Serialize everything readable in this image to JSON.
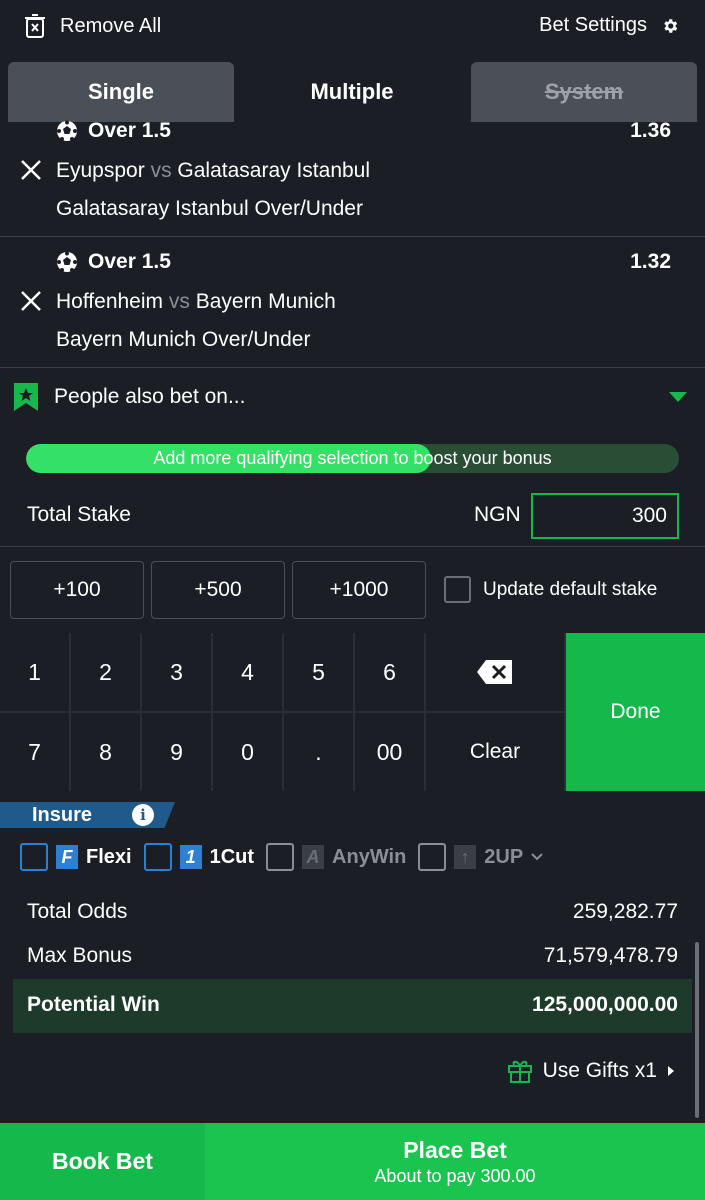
{
  "header": {
    "remove_all": "Remove All",
    "bet_settings": "Bet Settings"
  },
  "tabs": [
    {
      "label": "Single",
      "active": false
    },
    {
      "label": "Multiple",
      "active": true
    },
    {
      "label": "System",
      "disabled": true
    }
  ],
  "selections": [
    {
      "market": "Over 1.5",
      "odds": "1.36",
      "home": "Eyupspor",
      "vs": "vs",
      "away": "Galatasaray Istanbul",
      "submarket": "Galatasaray Istanbul Over/Under"
    },
    {
      "market": "Over 1.5",
      "odds": "1.32",
      "home": "Hoffenheim",
      "vs": "vs",
      "away": "Bayern Munich",
      "submarket": "Bayern Munich Over/Under"
    }
  ],
  "people_also_bet": "People also bet on...",
  "progress": {
    "text": "Add more qualifying selection to boost your bonus",
    "fraction": 0.62
  },
  "stake": {
    "label": "Total Stake",
    "currency": "NGN",
    "value": "300"
  },
  "quick_add": [
    "+100",
    "+500",
    "+1000"
  ],
  "update_default_stake": "Update default stake",
  "keypad": {
    "row1": [
      "1",
      "2",
      "3",
      "4",
      "5",
      "6"
    ],
    "row2": [
      "7",
      "8",
      "9",
      "0",
      ".",
      "00"
    ],
    "clear": "Clear",
    "done": "Done"
  },
  "insure": {
    "label": "Insure",
    "info": "i",
    "options": [
      {
        "badge": "F",
        "label": "Flexi"
      },
      {
        "badge": "1",
        "label": "1Cut"
      },
      {
        "badge": "A",
        "label": "AnyWin"
      },
      {
        "badge": "↑",
        "label": "2UP"
      }
    ]
  },
  "totals": {
    "total_odds_label": "Total Odds",
    "total_odds": "259,282.77",
    "max_bonus_label": "Max Bonus",
    "max_bonus": "71,579,478.79",
    "potential_win_label": "Potential Win",
    "potential_win": "125,000,000.00"
  },
  "gifts": "Use Gifts x1",
  "footer": {
    "book_bet": "Book Bet",
    "place_bet": "Place Bet",
    "about_to_pay": "About to pay 300.00"
  },
  "colors": {
    "bg": "#1b1e25",
    "green": "#15b84b",
    "progress_fill": "#34e066",
    "insure_blue": "#1f5a8a"
  }
}
